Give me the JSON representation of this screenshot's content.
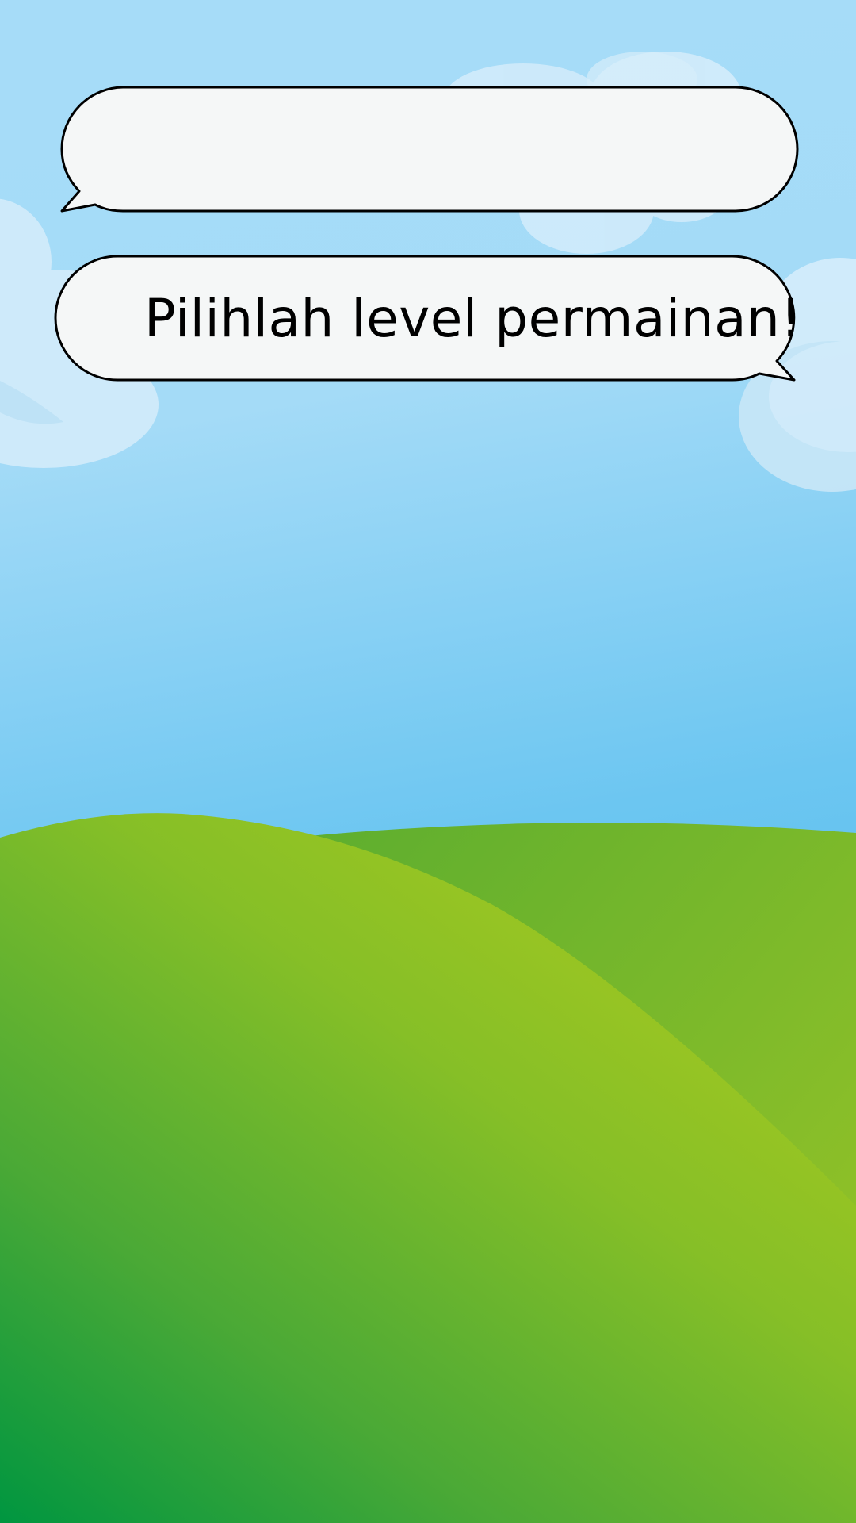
{
  "game": {
    "dialog_top": {
      "text": ""
    },
    "dialog_bottom": {
      "text": "Pilihlah level permainan!"
    }
  },
  "colors": {
    "sky_top": "#a6dcf8",
    "sky_bottom": "#3db3ea",
    "cloud": "#d3ecfb",
    "cloud_shade": "#c1e3f6",
    "hill_back": "#7fbd2a",
    "hill_front_light": "#a8c920",
    "hill_front_dark": "#009640",
    "bubble_fill": "#f5f7f7",
    "bubble_stroke": "#000000"
  }
}
